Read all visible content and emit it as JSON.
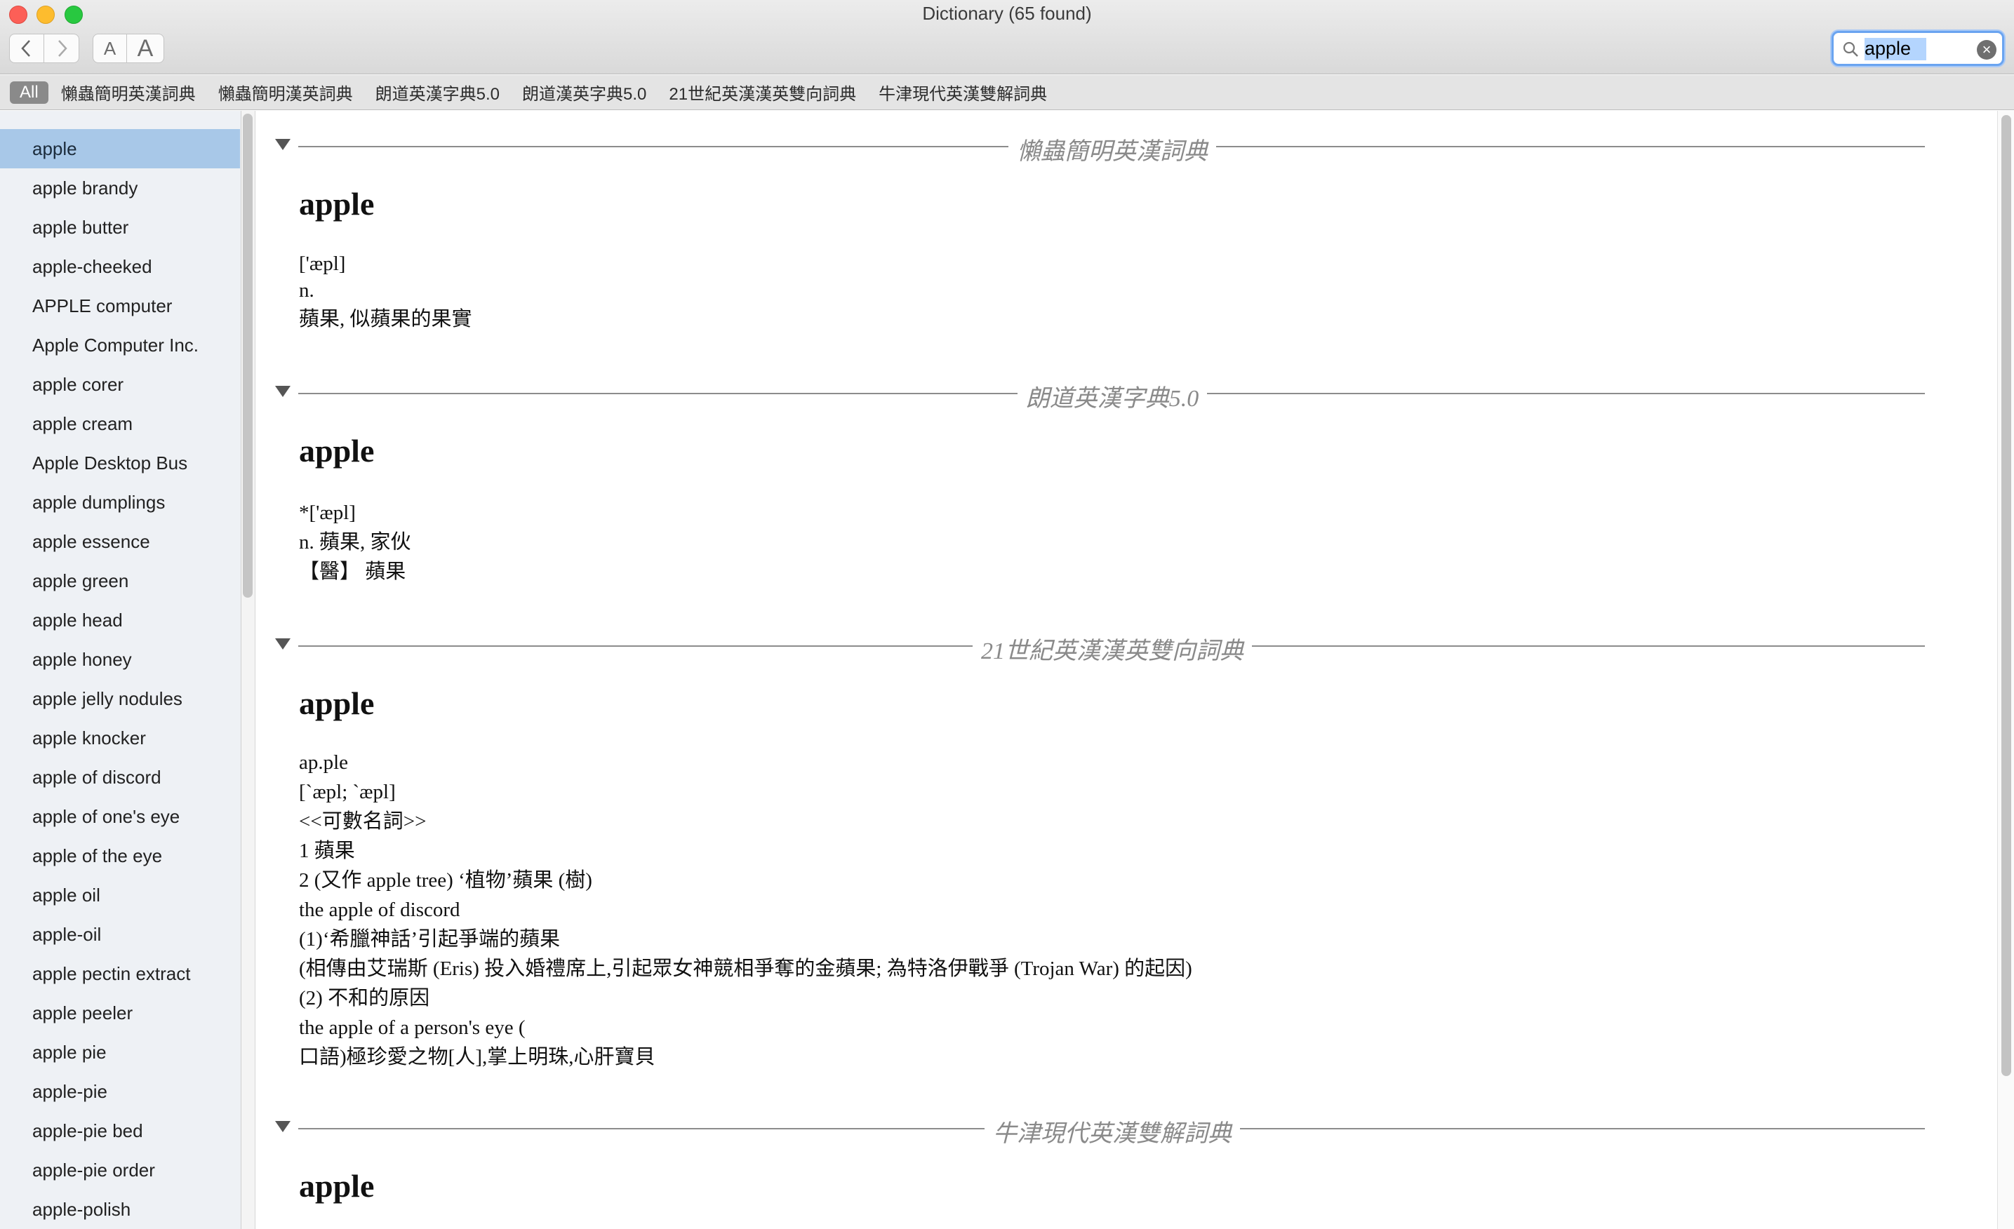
{
  "window": {
    "title": "Dictionary (65 found)"
  },
  "toolbar": {
    "back_label": "‹",
    "forward_label": "›",
    "font_smaller_label": "A",
    "font_larger_label": "A"
  },
  "search": {
    "value": "apple",
    "clear_label": "×"
  },
  "scope": {
    "items": [
      {
        "label": "All"
      },
      {
        "label": "懶蟲簡明英漢詞典"
      },
      {
        "label": "懶蟲簡明漢英詞典"
      },
      {
        "label": "朗道英漢字典5.0"
      },
      {
        "label": "朗道漢英字典5.0"
      },
      {
        "label": "21世紀英漢漢英雙向詞典"
      },
      {
        "label": "牛津現代英漢雙解詞典"
      }
    ]
  },
  "sidebar": {
    "items": [
      {
        "label": "apple"
      },
      {
        "label": "apple brandy"
      },
      {
        "label": "apple butter"
      },
      {
        "label": "apple-cheeked"
      },
      {
        "label": "APPLE computer"
      },
      {
        "label": "Apple Computer Inc."
      },
      {
        "label": "apple corer"
      },
      {
        "label": "apple cream"
      },
      {
        "label": "Apple Desktop Bus"
      },
      {
        "label": "apple dumplings"
      },
      {
        "label": "apple essence"
      },
      {
        "label": "apple green"
      },
      {
        "label": "apple head"
      },
      {
        "label": "apple honey"
      },
      {
        "label": "apple jelly nodules"
      },
      {
        "label": "apple knocker"
      },
      {
        "label": "apple of discord"
      },
      {
        "label": "apple of one's eye"
      },
      {
        "label": "apple of the eye"
      },
      {
        "label": "apple oil"
      },
      {
        "label": "apple-oil"
      },
      {
        "label": "apple pectin extract"
      },
      {
        "label": "apple peeler"
      },
      {
        "label": "apple pie"
      },
      {
        "label": "apple-pie"
      },
      {
        "label": "apple-pie bed"
      },
      {
        "label": "apple-pie order"
      },
      {
        "label": "apple-polish"
      }
    ]
  },
  "sections": [
    {
      "dictionary": "懶蟲簡明英漢詞典",
      "headword": "apple",
      "lines": [
        "['æpl]",
        "n.",
        "蘋果, 似蘋果的果實"
      ]
    },
    {
      "dictionary": "朗道英漢字典5.0",
      "headword": "apple",
      "lines": [
        "*['æpl]",
        "n. 蘋果, 家伙",
        "【醫】 蘋果"
      ]
    },
    {
      "dictionary": "21世紀英漢漢英雙向詞典",
      "headword": "apple",
      "lines": [
        "ap.ple",
        "[`æpl; `æpl]",
        "<<可數名詞>>",
        "1 蘋果",
        "2 (又作 apple tree) ‘植物’蘋果 (樹)",
        "the apple of discord",
        "(1)‘希臘神話’引起爭端的蘋果",
        "(相傳由艾瑞斯 (Eris) 投入婚禮席上,引起眾女神競相爭奪的金蘋果; 為特洛伊戰爭 (Trojan War) 的起因)",
        "(2) 不和的原因",
        "the apple of a person's eye (",
        "口語)極珍愛之物[人],掌上明珠,心肝寶貝"
      ]
    },
    {
      "dictionary": "牛津現代英漢雙解詞典",
      "headword": "apple",
      "lines": []
    }
  ]
}
